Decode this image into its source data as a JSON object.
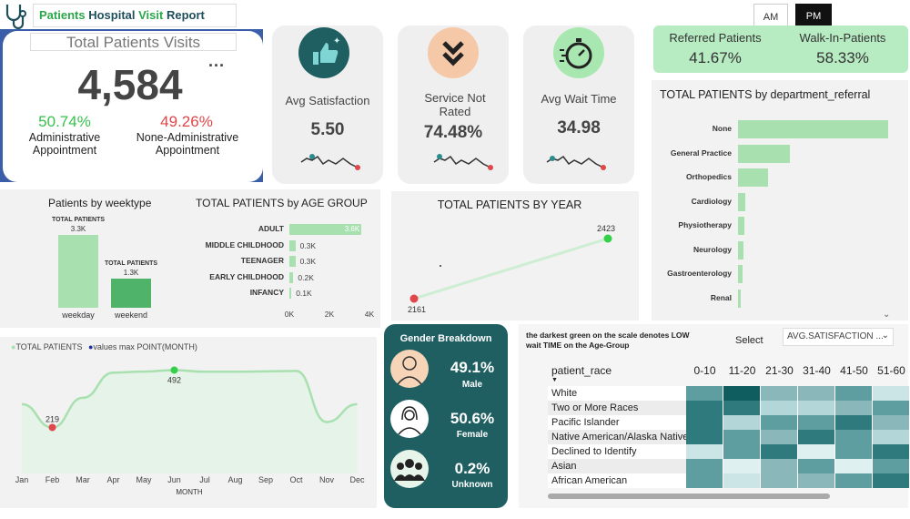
{
  "header": {
    "title_part1": "Patients",
    "title_part2": "Hospital",
    "title_part3": "Visit",
    "title_part4": "Report",
    "am_label": "AM",
    "pm_label": "PM"
  },
  "total_card": {
    "title": "Total Patients Visits",
    "value": "4,584",
    "more": "···",
    "admin_pct": "50.74%",
    "admin_label": "Administrative Appointment",
    "nonadmin_pct": "49.26%",
    "nonadmin_label": "None-Administrative Appointment"
  },
  "kpis": [
    {
      "label": "Avg Satisfaction",
      "value": "5.50"
    },
    {
      "label": "Service Not Rated",
      "value": "74.48%"
    },
    {
      "label": "Avg Wait Time",
      "value": "34.98"
    }
  ],
  "referral": {
    "referred_label": "Referred Patients",
    "referred_value": "41.67%",
    "walkin_label": "Walk-In-Patients",
    "walkin_value": "58.33%"
  },
  "colors": {
    "accent_green": "#2aa84a",
    "light_green": "#a8e0b0",
    "teal_dark": "#1f5f62",
    "red": "#e0464a"
  },
  "chart_data": [
    {
      "type": "bar",
      "title": "Patients by weektype",
      "categories": [
        "weekday",
        "weekend"
      ],
      "values": [
        3300,
        1300
      ],
      "data_labels": [
        "3.3K",
        "1.3K"
      ],
      "label_header": "TOTAL PATIENTS"
    },
    {
      "type": "bar",
      "title": "TOTAL PATIENTS by AGE GROUP",
      "orientation": "horizontal",
      "categories": [
        "ADULT",
        "MIDDLE CHILDHOOD",
        "TEENAGER",
        "EARLY CHILDHOOD",
        "INFANCY"
      ],
      "values": [
        3600,
        300,
        300,
        200,
        100
      ],
      "data_labels": [
        "3.6K",
        "0.3K",
        "0.3K",
        "0.2K",
        "0.1K"
      ],
      "ticks": [
        "0K",
        "2K",
        "4K"
      ],
      "xlim": [
        0,
        4000
      ]
    },
    {
      "type": "line",
      "title": "TOTAL PATIENTS BY YEAR",
      "x": [
        "2023",
        "2024"
      ],
      "values": [
        2161,
        2423
      ]
    },
    {
      "type": "bar",
      "title": "TOTAL PATIENTS by department_referral",
      "orientation": "horizontal",
      "categories": [
        "None",
        "General Practice",
        "Orthopedics",
        "Cardiology",
        "Physiotherapy",
        "Neurology",
        "Gastroenterology",
        "Renal"
      ],
      "values": [
        2500,
        870,
        500,
        120,
        100,
        90,
        80,
        40
      ]
    },
    {
      "type": "area",
      "legend": [
        "TOTAL PATIENTS",
        "values max POINT(MONTH)"
      ],
      "xlabel": "MONTH",
      "categories": [
        "Jan",
        "Feb",
        "Mar",
        "Apr",
        "May",
        "Jun",
        "Jul",
        "Aug",
        "Sep",
        "Oct",
        "Nov",
        "Dec"
      ],
      "values": [
        330,
        219,
        360,
        480,
        485,
        492,
        484,
        484,
        486,
        488,
        245,
        330
      ],
      "min_label": "219",
      "max_label": "492"
    },
    {
      "type": "heatmap",
      "note": "the darkest green on the scale denotes LOW wait TIME on the Age-Group",
      "select_label": "Select",
      "select_value": "AVG.SATISFACTION ...",
      "row_header": "patient_race",
      "columns": [
        "0-10",
        "11-20",
        "21-30",
        "31-40",
        "41-50",
        "51-60"
      ],
      "rows": [
        "White",
        "Two or More Races",
        "Pacific Islander",
        "Native American/Alaska Native",
        "Declined to Identify",
        "Asian",
        "African American"
      ],
      "values": [
        [
          3,
          1,
          4,
          4,
          3,
          6
        ],
        [
          2,
          2,
          5,
          5,
          4,
          3
        ],
        [
          2,
          5,
          3,
          3,
          2,
          4
        ],
        [
          2,
          3,
          4,
          2,
          3,
          5
        ],
        [
          6,
          3,
          2,
          7,
          3,
          2
        ],
        [
          3,
          7,
          4,
          3,
          7,
          3
        ],
        [
          3,
          6,
          4,
          4,
          3,
          2
        ]
      ]
    }
  ],
  "gender": {
    "title": "Gender Breakdown",
    "items": [
      {
        "value": "49.1%",
        "label": "Male"
      },
      {
        "value": "50.6%",
        "label": "Female"
      },
      {
        "value": "0.2%",
        "label": "Unknown"
      }
    ]
  }
}
